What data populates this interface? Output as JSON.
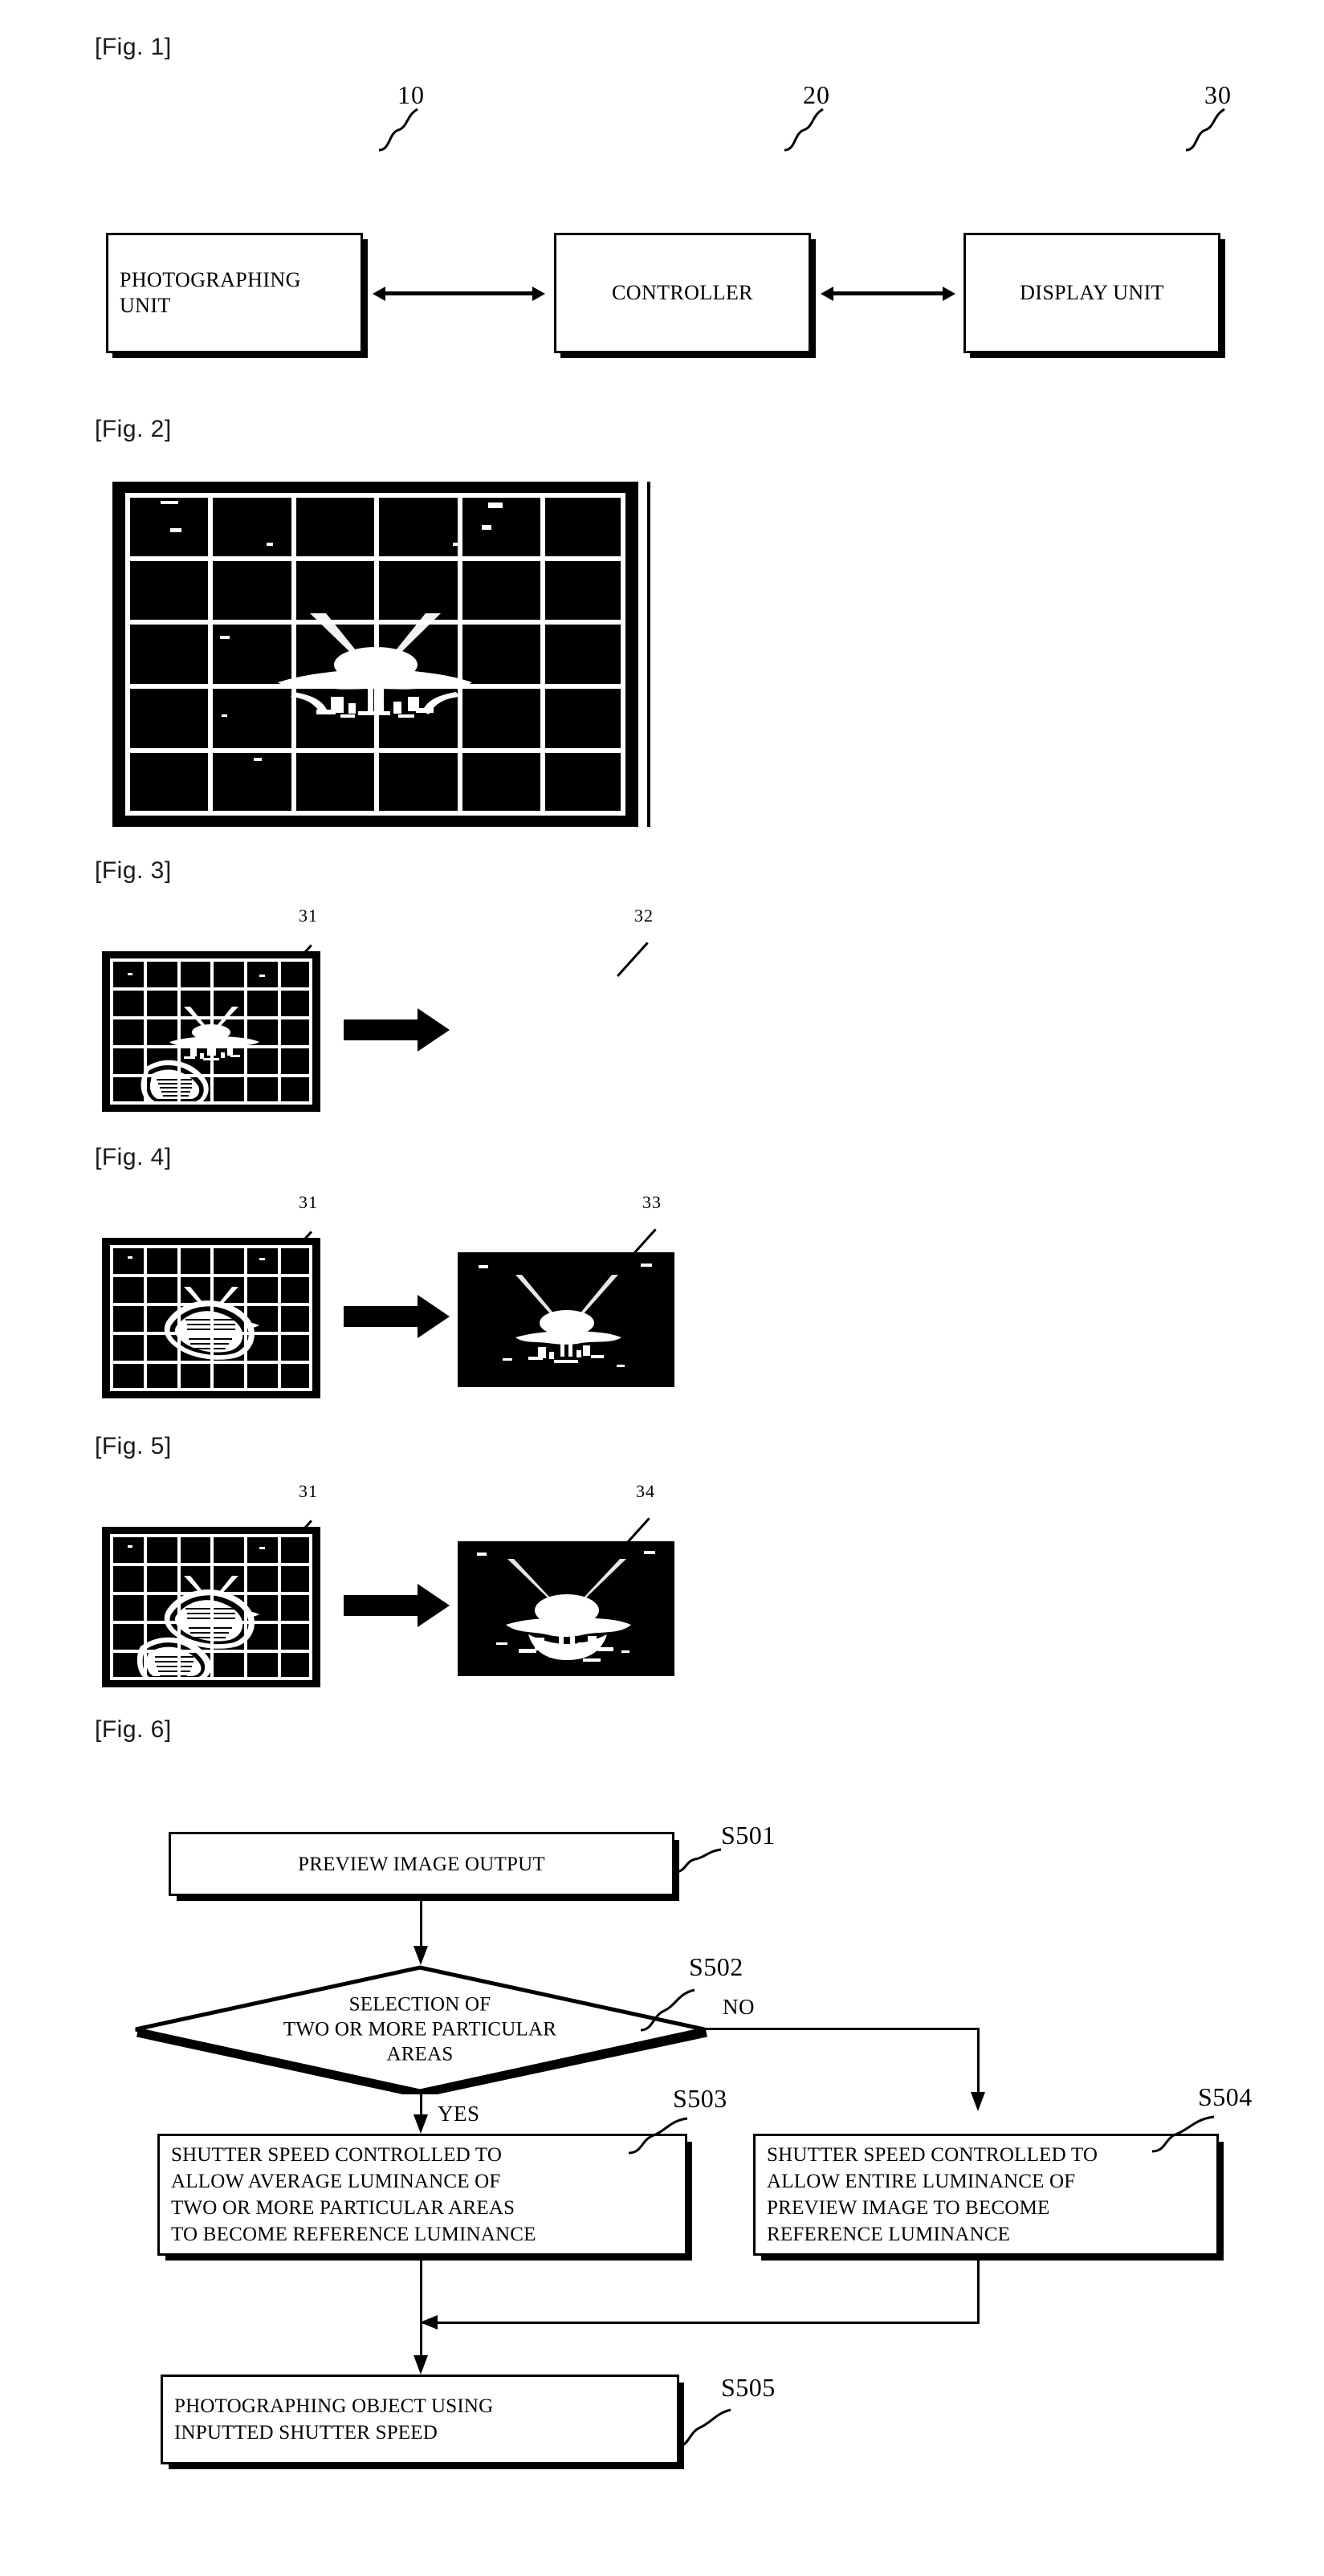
{
  "document": {
    "type": "patent-drawing-sheet",
    "figures": [
      {
        "label": "[Fig. 1]"
      },
      {
        "label": "[Fig. 2]"
      },
      {
        "label": "[Fig. 3]"
      },
      {
        "label": "[Fig. 4]"
      },
      {
        "label": "[Fig. 5]"
      },
      {
        "label": "[Fig. 6]"
      }
    ]
  },
  "fig1": {
    "label": "[Fig. 1]",
    "blocks": [
      {
        "text": "PHOTOGRAPHING UNIT",
        "ref": "10"
      },
      {
        "text": "CONTROLLER",
        "ref": "20"
      },
      {
        "text": "DISPLAY UNIT",
        "ref": "30"
      }
    ],
    "connector": "double-headed-arrow"
  },
  "fig2": {
    "label": "[Fig. 2]",
    "caption": "preview image divided into grid areas",
    "grid": {
      "columns": 6,
      "rows": 5
    }
  },
  "fig3": {
    "label": "[Fig. 3]",
    "left_ref": "31",
    "right_ref": "32",
    "grid": {
      "columns": 6,
      "rows": 5
    },
    "touch_points": 1
  },
  "fig4": {
    "label": "[Fig. 4]",
    "left_ref": "31",
    "right_ref": "33",
    "grid": {
      "columns": 6,
      "rows": 5
    },
    "touch_points": 1
  },
  "fig5": {
    "label": "[Fig. 5]",
    "left_ref": "31",
    "right_ref": "34",
    "grid": {
      "columns": 6,
      "rows": 5
    },
    "touch_points": 2
  },
  "fig6": {
    "label": "[Fig. 6]",
    "steps": [
      {
        "id": "S501",
        "text": "PREVIEW IMAGE OUTPUT",
        "shape": "process"
      },
      {
        "id": "S502",
        "text": "SELECTION OF\nTWO OR MORE PARTICULAR\nAREAS",
        "shape": "decision"
      },
      {
        "id": "S503",
        "text": "SHUTTER SPEED CONTROLLED TO\nALLOW AVERAGE LUMINANCE OF\nTWO OR MORE PARTICULAR AREAS\nTO BECOME REFERENCE LUMINANCE",
        "shape": "process"
      },
      {
        "id": "S504",
        "text": "SHUTTER SPEED CONTROLLED TO\nALLOW ENTIRE LUMINANCE OF\nPREVIEW IMAGE TO BECOME\nREFERENCE LUMINANCE",
        "shape": "process"
      },
      {
        "id": "S505",
        "text": "PHOTOGRAPHING OBJECT USING\nINPUTTED SHUTTER SPEED",
        "shape": "process"
      }
    ],
    "branch_yes": "YES",
    "branch_no": "NO",
    "step1_line1": "PREVIEW IMAGE OUTPUT",
    "step2_line1": "SELECTION OF",
    "step2_line2": "TWO OR MORE PARTICULAR",
    "step2_line3": "AREAS",
    "step3_line1": "SHUTTER SPEED CONTROLLED TO",
    "step3_line2": "ALLOW AVERAGE LUMINANCE OF",
    "step3_line3": "TWO OR MORE PARTICULAR AREAS",
    "step3_line4": "TO BECOME REFERENCE LUMINANCE",
    "step4_line1": "SHUTTER SPEED CONTROLLED TO",
    "step4_line2": "ALLOW ENTIRE LUMINANCE OF",
    "step4_line3": "PREVIEW IMAGE TO BECOME",
    "step4_line4": "REFERENCE LUMINANCE",
    "step5_line1": "PHOTOGRAPHING OBJECT USING",
    "step5_line2": "INPUTTED SHUTTER SPEED",
    "id1": "S501",
    "id2": "S502",
    "id3": "S503",
    "id4": "S504",
    "id5": "S505"
  },
  "colors": {
    "ink": "#000000",
    "paper": "#ffffff",
    "label_gray": "#1a1a1a"
  }
}
